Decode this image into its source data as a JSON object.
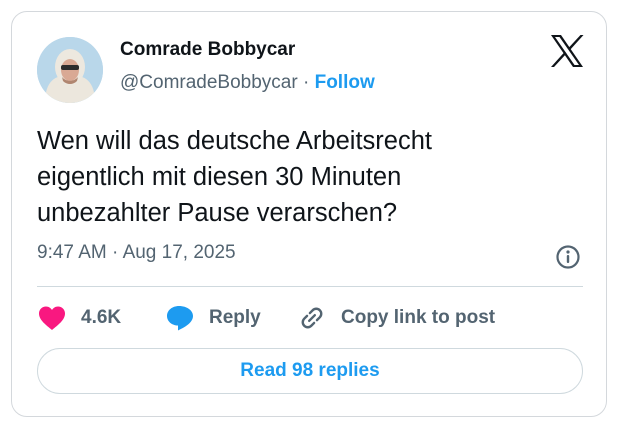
{
  "author": {
    "display_name": "Comrade Bobbycar",
    "handle": "@ComradeBobbycar",
    "separator": "·",
    "follow_label": "Follow",
    "avatar_icon": "avatar-person-hoodie"
  },
  "platform_icon": "x-logo-icon",
  "tweet": {
    "text": "Wen will das deutsche Arbeitsrecht\neigentlich mit diesen 30 Minuten\nunbezahlter Pause verarschen?",
    "time": "9:47 AM",
    "separator": "·",
    "date": "Aug 17, 2025"
  },
  "actions": {
    "like_count": "4.6K",
    "reply_label": "Reply",
    "copy_label": "Copy link to post"
  },
  "read_replies_label": "Read 98 replies",
  "colors": {
    "accent": "#1d9bf0",
    "like": "#f91880",
    "text": "#0f1419",
    "muted": "#536471",
    "border": "#cfd9de"
  }
}
